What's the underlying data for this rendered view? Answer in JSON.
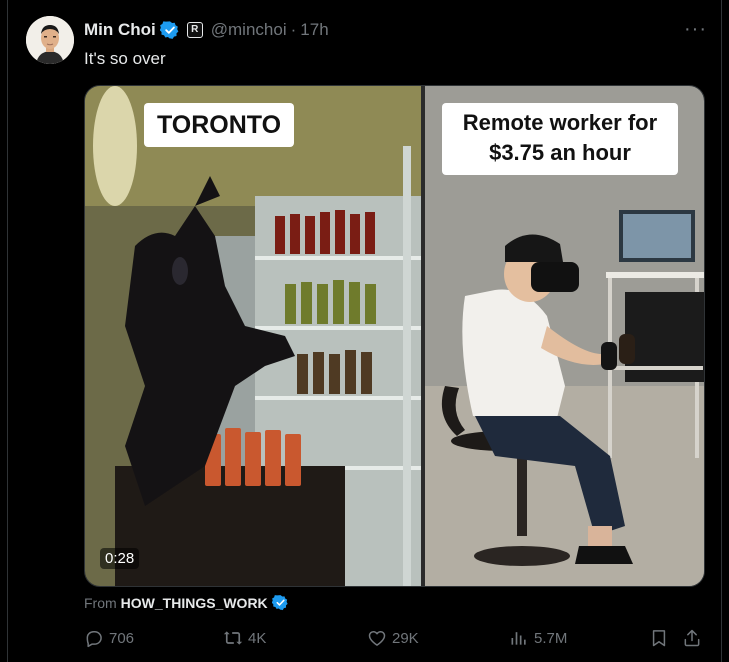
{
  "post": {
    "author_name": "Min Choi",
    "handle": "@minchoi",
    "separator": "·",
    "time": "17h",
    "affiliate_badge_letter": "R",
    "text": "It's so over",
    "more_label": "···"
  },
  "media": {
    "left_caption": "TORONTO",
    "right_caption_line1": "Remote worker for",
    "right_caption_line2": "$3.75 an hour",
    "duration": "0:28"
  },
  "source": {
    "prefix": "From",
    "name": "HOW_THINGS_WORK"
  },
  "actions": {
    "replies": "706",
    "reposts": "4K",
    "likes": "29K",
    "views": "5.7M"
  },
  "icons": {
    "verified": "verified-badge-icon",
    "reply": "reply-icon",
    "repost": "repost-icon",
    "like": "heart-icon",
    "views": "views-chart-icon",
    "bookmark": "bookmark-icon",
    "share": "share-icon"
  },
  "colors": {
    "background": "#000000",
    "text_primary": "#e7e9ea",
    "text_secondary": "#71767b",
    "verified_blue": "#1d9bf0",
    "border": "#2f3336"
  }
}
